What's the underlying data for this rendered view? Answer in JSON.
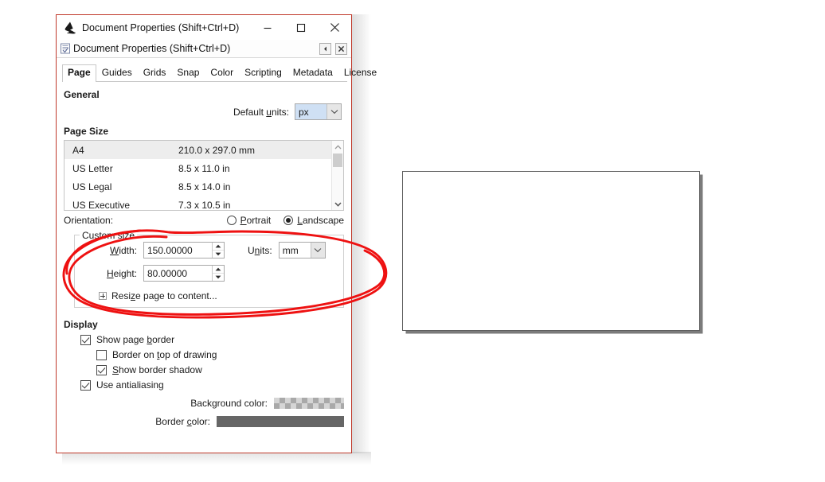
{
  "window": {
    "title": "Document Properties (Shift+Ctrl+D)",
    "app_icon": "inkscape-logo-icon",
    "minimize_label": "–",
    "maximize_label": "□",
    "close_label": "✕",
    "border_color": "#c0392b"
  },
  "dock": {
    "title": "Document Properties (Shift+Ctrl+D)",
    "icon": "document-properties-icon",
    "collapse_label": "◂",
    "close_label": "✖"
  },
  "tabs": [
    {
      "label": "Page",
      "active": true
    },
    {
      "label": "Guides",
      "active": false
    },
    {
      "label": "Grids",
      "active": false
    },
    {
      "label": "Snap",
      "active": false
    },
    {
      "label": "Color",
      "active": false
    },
    {
      "label": "Scripting",
      "active": false
    },
    {
      "label": "Metadata",
      "active": false
    },
    {
      "label": "License",
      "active": false
    }
  ],
  "general": {
    "heading": "General",
    "default_units_label_pre": "Default ",
    "default_units_label_u": "u",
    "default_units_label_post": "nits:",
    "default_units_value": "px"
  },
  "page_size": {
    "heading": "Page Size",
    "columns": [
      "name",
      "dimensions"
    ],
    "rows": [
      {
        "name": "A4",
        "dimensions": "210.0 x 297.0 mm",
        "selected": true
      },
      {
        "name": "US Letter",
        "dimensions": "8.5 x 11.0 in",
        "selected": false
      },
      {
        "name": "US Legal",
        "dimensions": "8.5 x 14.0 in",
        "selected": false
      },
      {
        "name": "US Executive",
        "dimensions": "7.3 x 10.5 in",
        "selected": false
      }
    ],
    "scroll_up_icon": "chevron-up-icon",
    "scroll_down_icon": "chevron-down-icon"
  },
  "orientation": {
    "label": "Orientation:",
    "options": [
      {
        "label_pre": "",
        "label_u": "P",
        "label_post": "ortrait",
        "selected": false
      },
      {
        "label_pre": "",
        "label_u": "L",
        "label_post": "andscape",
        "selected": true
      }
    ]
  },
  "custom_size": {
    "legend": "Custom size",
    "width_label_pre": "",
    "width_label_u": "W",
    "width_label_post": "idth:",
    "width_value": "150.00000",
    "height_label_pre": "",
    "height_label_u": "H",
    "height_label_post": "eight:",
    "height_value": "80.00000",
    "units_label_pre": "U",
    "units_label_u": "n",
    "units_label_post": "its:",
    "units_value": "mm",
    "resize_pre": "Resi",
    "resize_u": "z",
    "resize_post": "e page to content..."
  },
  "display": {
    "heading": "Display",
    "checks": [
      {
        "pre": "Show page ",
        "u": "b",
        "post": "order",
        "checked": true,
        "indent": false
      },
      {
        "pre": "Border on ",
        "u": "t",
        "post": "op of drawing",
        "checked": false,
        "indent": true
      },
      {
        "pre": "",
        "u": "S",
        "post": "how border shadow",
        "checked": true,
        "indent": true
      },
      {
        "pre": "Use antialiasing",
        "u": "",
        "post": "",
        "checked": true,
        "indent": false
      }
    ],
    "background_color_label": "Background color:",
    "background_color_value": "transparent-checker",
    "border_color_label_pre": "Border ",
    "border_color_label_u": "c",
    "border_color_label_post": "olor:",
    "border_color_value": "#666666"
  },
  "canvas": {
    "page_preview_name": "document-page-preview",
    "page_border_color": "#5f5f5f",
    "page_fill": "#ffffff"
  },
  "annotation": {
    "name": "red-ellipse-highlight",
    "color": "#ee1111",
    "description": "hand-drawn red ellipse circling the Custom size group"
  }
}
